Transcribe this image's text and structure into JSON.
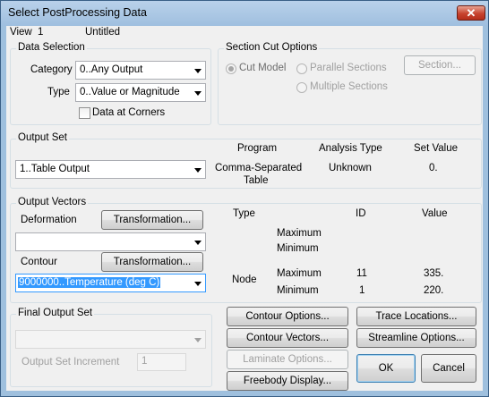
{
  "window": {
    "title": "Select PostProcessing Data",
    "close_glyph": "✕"
  },
  "view": {
    "label": "View",
    "number": "1",
    "name": "Untitled"
  },
  "data_selection": {
    "title": "Data Selection",
    "category_label": "Category",
    "category_value": "0..Any Output",
    "type_label": "Type",
    "type_value": "0..Value or Magnitude",
    "corners_label": "Data at Corners"
  },
  "section_cut": {
    "title": "Section Cut Options",
    "cut_model": "Cut Model",
    "parallel": "Parallel Sections",
    "multiple": "Multiple Sections",
    "section_button": "Section..."
  },
  "output_set": {
    "title": "Output Set",
    "value": "1..Table Output",
    "headers": {
      "program": "Program",
      "analysis_type": "Analysis Type",
      "set_value": "Set Value"
    },
    "program_line1": "Comma-Separated",
    "program_line2": "Table",
    "analysis_type": "Unknown",
    "set_value": "0."
  },
  "output_vectors": {
    "title": "Output Vectors",
    "deformation_label": "Deformation",
    "deformation_transform": "Transformation...",
    "deformation_value": "",
    "contour_label": "Contour",
    "contour_transform": "Transformation...",
    "contour_value": "9000000..Temperature (deg C)",
    "headers": {
      "type": "Type",
      "id": "ID",
      "value": "Value"
    },
    "deformation_rows": [
      {
        "label": "Maximum"
      },
      {
        "label": "Minimum"
      }
    ],
    "contour_type": "Node",
    "contour_rows": [
      {
        "label": "Maximum",
        "id": "11",
        "value": "335."
      },
      {
        "label": "Minimum",
        "id": "1",
        "value": "220."
      }
    ]
  },
  "final_output_set": {
    "title": "Final Output Set",
    "value": "",
    "increment_label": "Output Set Increment",
    "increment_value": "1"
  },
  "buttons": {
    "contour_options": "Contour Options...",
    "trace_locations": "Trace Locations...",
    "contour_vectors": "Contour Vectors...",
    "streamline_options": "Streamline Options...",
    "laminate_options": "Laminate Options...",
    "freebody_display": "Freebody Display...",
    "ok": "OK",
    "cancel": "Cancel"
  }
}
